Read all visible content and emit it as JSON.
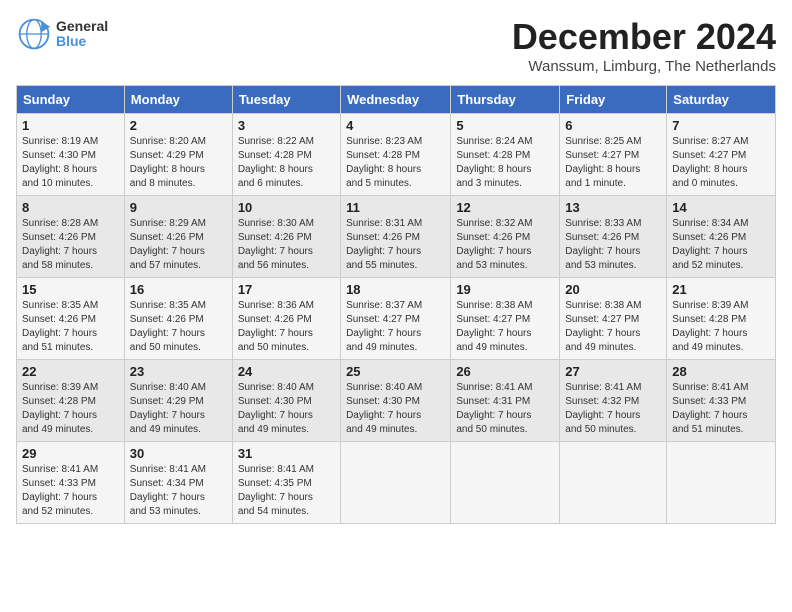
{
  "header": {
    "logo_line1": "General",
    "logo_line2": "Blue",
    "title": "December 2024",
    "subtitle": "Wanssum, Limburg, The Netherlands"
  },
  "calendar": {
    "headers": [
      "Sunday",
      "Monday",
      "Tuesday",
      "Wednesday",
      "Thursday",
      "Friday",
      "Saturday"
    ],
    "weeks": [
      [
        null,
        {
          "day": "2",
          "info": "Sunrise: 8:20 AM\nSunset: 4:29 PM\nDaylight: 8 hours\nand 8 minutes."
        },
        {
          "day": "3",
          "info": "Sunrise: 8:22 AM\nSunset: 4:28 PM\nDaylight: 8 hours\nand 6 minutes."
        },
        {
          "day": "4",
          "info": "Sunrise: 8:23 AM\nSunset: 4:28 PM\nDaylight: 8 hours\nand 5 minutes."
        },
        {
          "day": "5",
          "info": "Sunrise: 8:24 AM\nSunset: 4:28 PM\nDaylight: 8 hours\nand 3 minutes."
        },
        {
          "day": "6",
          "info": "Sunrise: 8:25 AM\nSunset: 4:27 PM\nDaylight: 8 hours\nand 1 minute."
        },
        {
          "day": "7",
          "info": "Sunrise: 8:27 AM\nSunset: 4:27 PM\nDaylight: 8 hours\nand 0 minutes."
        }
      ],
      [
        {
          "day": "1",
          "info": "Sunrise: 8:19 AM\nSunset: 4:30 PM\nDaylight: 8 hours\nand 10 minutes."
        },
        null,
        null,
        null,
        null,
        null,
        null
      ],
      [
        {
          "day": "8",
          "info": "Sunrise: 8:28 AM\nSunset: 4:26 PM\nDaylight: 7 hours\nand 58 minutes."
        },
        {
          "day": "9",
          "info": "Sunrise: 8:29 AM\nSunset: 4:26 PM\nDaylight: 7 hours\nand 57 minutes."
        },
        {
          "day": "10",
          "info": "Sunrise: 8:30 AM\nSunset: 4:26 PM\nDaylight: 7 hours\nand 56 minutes."
        },
        {
          "day": "11",
          "info": "Sunrise: 8:31 AM\nSunset: 4:26 PM\nDaylight: 7 hours\nand 55 minutes."
        },
        {
          "day": "12",
          "info": "Sunrise: 8:32 AM\nSunset: 4:26 PM\nDaylight: 7 hours\nand 53 minutes."
        },
        {
          "day": "13",
          "info": "Sunrise: 8:33 AM\nSunset: 4:26 PM\nDaylight: 7 hours\nand 53 minutes."
        },
        {
          "day": "14",
          "info": "Sunrise: 8:34 AM\nSunset: 4:26 PM\nDaylight: 7 hours\nand 52 minutes."
        }
      ],
      [
        {
          "day": "15",
          "info": "Sunrise: 8:35 AM\nSunset: 4:26 PM\nDaylight: 7 hours\nand 51 minutes."
        },
        {
          "day": "16",
          "info": "Sunrise: 8:35 AM\nSunset: 4:26 PM\nDaylight: 7 hours\nand 50 minutes."
        },
        {
          "day": "17",
          "info": "Sunrise: 8:36 AM\nSunset: 4:26 PM\nDaylight: 7 hours\nand 50 minutes."
        },
        {
          "day": "18",
          "info": "Sunrise: 8:37 AM\nSunset: 4:27 PM\nDaylight: 7 hours\nand 49 minutes."
        },
        {
          "day": "19",
          "info": "Sunrise: 8:38 AM\nSunset: 4:27 PM\nDaylight: 7 hours\nand 49 minutes."
        },
        {
          "day": "20",
          "info": "Sunrise: 8:38 AM\nSunset: 4:27 PM\nDaylight: 7 hours\nand 49 minutes."
        },
        {
          "day": "21",
          "info": "Sunrise: 8:39 AM\nSunset: 4:28 PM\nDaylight: 7 hours\nand 49 minutes."
        }
      ],
      [
        {
          "day": "22",
          "info": "Sunrise: 8:39 AM\nSunset: 4:28 PM\nDaylight: 7 hours\nand 49 minutes."
        },
        {
          "day": "23",
          "info": "Sunrise: 8:40 AM\nSunset: 4:29 PM\nDaylight: 7 hours\nand 49 minutes."
        },
        {
          "day": "24",
          "info": "Sunrise: 8:40 AM\nSunset: 4:30 PM\nDaylight: 7 hours\nand 49 minutes."
        },
        {
          "day": "25",
          "info": "Sunrise: 8:40 AM\nSunset: 4:30 PM\nDaylight: 7 hours\nand 49 minutes."
        },
        {
          "day": "26",
          "info": "Sunrise: 8:41 AM\nSunset: 4:31 PM\nDaylight: 7 hours\nand 50 minutes."
        },
        {
          "day": "27",
          "info": "Sunrise: 8:41 AM\nSunset: 4:32 PM\nDaylight: 7 hours\nand 50 minutes."
        },
        {
          "day": "28",
          "info": "Sunrise: 8:41 AM\nSunset: 4:33 PM\nDaylight: 7 hours\nand 51 minutes."
        }
      ],
      [
        {
          "day": "29",
          "info": "Sunrise: 8:41 AM\nSunset: 4:33 PM\nDaylight: 7 hours\nand 52 minutes."
        },
        {
          "day": "30",
          "info": "Sunrise: 8:41 AM\nSunset: 4:34 PM\nDaylight: 7 hours\nand 53 minutes."
        },
        {
          "day": "31",
          "info": "Sunrise: 8:41 AM\nSunset: 4:35 PM\nDaylight: 7 hours\nand 54 minutes."
        },
        null,
        null,
        null,
        null
      ]
    ]
  }
}
